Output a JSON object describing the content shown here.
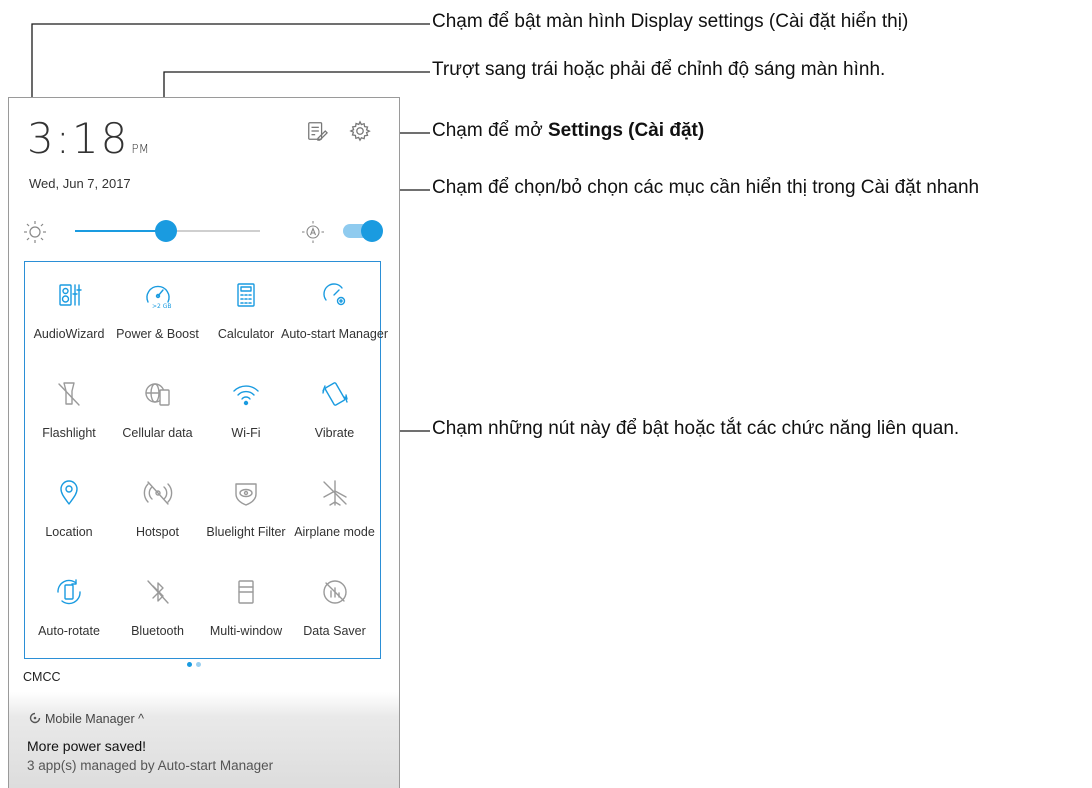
{
  "status": {
    "time": "3:18",
    "ampm": "PM",
    "date": "Wed, Jun 7, 2017"
  },
  "brightness": {
    "level_percent": 49,
    "auto_enabled": true
  },
  "accent_color": "#1a9be0",
  "tiles": [
    {
      "label": "AudioWizard",
      "icon": "audiowizard-icon",
      "active": true
    },
    {
      "label": "Power & Boost",
      "icon": "power-boost-icon",
      "active": true
    },
    {
      "label": "Calculator",
      "icon": "calculator-icon",
      "active": true
    },
    {
      "label": "Auto-start Manager",
      "icon": "auto-start-icon",
      "active": true
    },
    {
      "label": "Flashlight",
      "icon": "flashlight-icon",
      "active": false
    },
    {
      "label": "Cellular data",
      "icon": "cellular-data-icon",
      "active": false
    },
    {
      "label": "Wi-Fi",
      "icon": "wifi-icon",
      "active": true
    },
    {
      "label": "Vibrate",
      "icon": "vibrate-icon",
      "active": true
    },
    {
      "label": "Location",
      "icon": "location-icon",
      "active": true
    },
    {
      "label": "Hotspot",
      "icon": "hotspot-icon",
      "active": false
    },
    {
      "label": "Bluelight Filter",
      "icon": "bluelight-filter-icon",
      "active": false
    },
    {
      "label": "Airplane mode",
      "icon": "airplane-icon",
      "active": false
    },
    {
      "label": "Auto-rotate",
      "icon": "auto-rotate-icon",
      "active": true
    },
    {
      "label": "Bluetooth",
      "icon": "bluetooth-icon",
      "active": false
    },
    {
      "label": "Multi-window",
      "icon": "multi-window-icon",
      "active": false
    },
    {
      "label": "Data Saver",
      "icon": "data-saver-icon",
      "active": false
    }
  ],
  "carrier": "CMCC",
  "notification": {
    "app": "Mobile Manager",
    "title": "More power saved!",
    "body": "3 app(s) managed by Auto-start Manager"
  },
  "callouts": {
    "display_settings": "Chạm để bật màn hình Display settings (Cài đặt hiển thị)",
    "brightness": "Trượt sang trái hoặc phải để chỉnh độ sáng màn hình.",
    "settings_prefix": "Chạm để mở ",
    "settings_bold": "Settings (Cài đặt)",
    "quick_settings": "Chạm để chọn/bỏ chọn các mục cần hiển thị trong Cài đặt nhanh",
    "toggles": "Chạm những nút này để bật hoặc tắt các chức năng liên quan."
  }
}
